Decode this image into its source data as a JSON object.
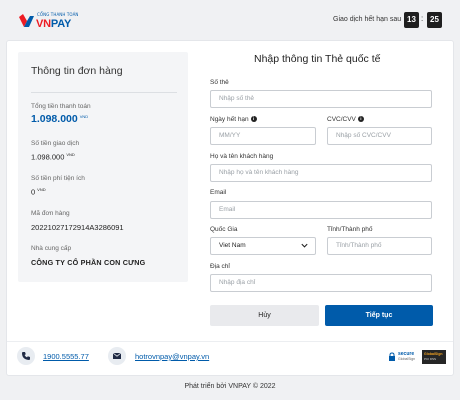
{
  "header": {
    "logo_small": "CỔNG THANH TOÁN",
    "logo_vn": "VN",
    "logo_pay": "PAY",
    "logo_reg": "QR",
    "countdown_label": "Giao dịch hết hạn sau",
    "minutes": "13",
    "separator": ":",
    "seconds": "25"
  },
  "order": {
    "title": "Thông tin đơn hàng",
    "total_label": "Tổng tiền thanh toán",
    "total_value": "1.098.000",
    "total_currency": "VND",
    "transaction_label": "Số tiền giao dịch",
    "transaction_value": "1.098.000",
    "transaction_currency": "VND",
    "fee_label": "Số tiền phí tiện ích",
    "fee_value": "0",
    "fee_currency": "VND",
    "order_code_label": "Mã đơn hàng",
    "order_code_value": "20221027172914A3286091",
    "provider_label": "Nhà cung cấp",
    "provider_value": "CÔNG TY CỔ PHẦN CON CƯNG"
  },
  "form": {
    "title": "Nhập thông tin Thẻ quốc tế",
    "card_number_label": "Số thẻ",
    "card_number_placeholder": "Nhập số thẻ",
    "expiry_label": "Ngày hết hạn",
    "expiry_placeholder": "MM/YY",
    "cvc_label": "CVC/CVV",
    "cvc_placeholder": "Nhập số CVC/CVV",
    "name_label": "Họ và tên khách hàng",
    "name_placeholder": "Nhập họ và tên khách hàng",
    "email_label": "Email",
    "email_placeholder": "Email",
    "country_label": "Quốc Gia",
    "country_value": "Viet Nam",
    "city_label": "Tỉnh/Thành phố",
    "city_placeholder": "Tỉnh/Thành phố",
    "address_label": "Địa chỉ",
    "address_placeholder": "Nhập địa chỉ",
    "info_glyph": "i",
    "cancel_label": "Hủy",
    "continue_label": "Tiếp tục"
  },
  "footer": {
    "phone": "1900.5555.77",
    "email": "hotrovnpay@vnpay.vn",
    "secure_title": "secure",
    "secure_sub": "GlobalSign",
    "badge_line1": "GlobalSign",
    "badge_line2": "PCI DSS",
    "powered": "Phát triển bởi VNPAY © 2022"
  },
  "colors": {
    "brand_blue": "#005baa",
    "brand_red": "#ed1c24",
    "timer_bg": "#1f1f1f"
  },
  "icons": [
    "vnpay-logo-icon",
    "phone-icon",
    "mail-icon",
    "info-icon",
    "chevron-down-icon",
    "lock-icon"
  ]
}
